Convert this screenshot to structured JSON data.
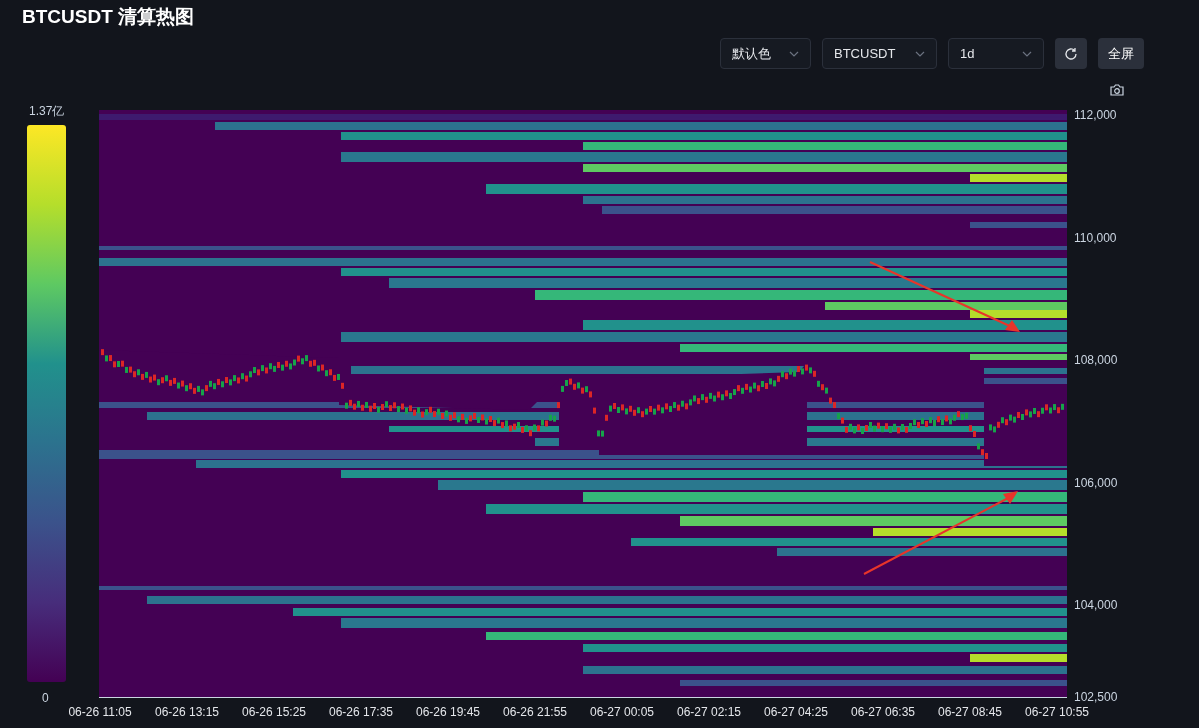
{
  "title": "BTCUSDT 清算热图",
  "controls": {
    "dropdowns": [
      {
        "value": "默认色"
      },
      {
        "value": "BTCUSDT"
      },
      {
        "value": "1d"
      }
    ],
    "fullscreen_button": "全屏"
  },
  "color_scale": {
    "max_label": "1.37亿",
    "min_label": "0"
  },
  "chart": {
    "y_axis_labels": [
      "112,000",
      "110,000",
      "108,000",
      "106,000",
      "104,000",
      "102,500"
    ],
    "x_axis_labels": [
      "06-26 11:05",
      "06-26 13:15",
      "06-26 15:25",
      "06-26 17:35",
      "06-26 19:45",
      "06-26 21:55",
      "06-27 00:05",
      "06-27 02:15",
      "06-27 04:25",
      "06-27 06:35",
      "06-27 08:45",
      "06-27 10:55"
    ]
  }
}
